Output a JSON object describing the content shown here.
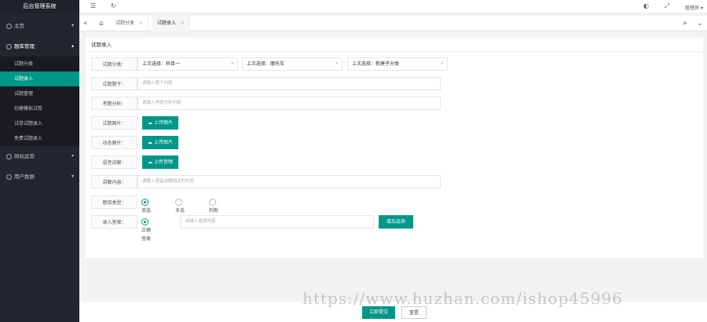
{
  "app": {
    "title": "后台管理系统"
  },
  "sidebar": {
    "items": [
      {
        "label": "主页",
        "arrow": "▾"
      },
      {
        "label": "题库管理",
        "arrow": "▴"
      },
      {
        "label": "网站运营",
        "arrow": "▾"
      },
      {
        "label": "用户数据",
        "arrow": "▾"
      }
    ],
    "sub": [
      "试题分类",
      "试题录入",
      "试题管理",
      "创建模拟试卷",
      "试卷试题录入",
      "免费试题录入"
    ]
  },
  "header": {
    "menu_icon": "☰",
    "refresh_icon": "↻",
    "skin_icon": "◐",
    "full_icon": "⤢",
    "user": "管理员 ▾"
  },
  "tabs": {
    "prev": "«",
    "home": "⌂",
    "items": [
      "试题分类",
      "试题录入"
    ],
    "close": "×",
    "next": "»",
    "more": "⌄"
  },
  "card": {
    "title": "试题录入"
  },
  "form": {
    "category_label": "试题分类：",
    "selects": [
      "上次选择：科目一",
      "上次选择：摩托车",
      "上次选择：新建子分类"
    ],
    "caret": "▾",
    "stem_label": "试题题干：",
    "stem_placeholder": "请输入题干内容",
    "analysis_label": "考题分析：",
    "analysis_placeholder": "请输入考题分析内容",
    "image_label": "试题图片：",
    "image_btn": "上传图片",
    "gif_label": "动态图片：",
    "gif_btn": "上传图片",
    "audio_label": "语音讲解：",
    "audio_btn": "上传音频",
    "explain_label": "讲解内容：",
    "explain_placeholder": "请输入语音讲解相关的内容",
    "type_label": "题目类型：",
    "types": [
      "单选",
      "多选",
      "判断"
    ],
    "answer_label": "录入答案：",
    "answer_radio": "正确答案",
    "answer_placeholder": "请输入选项内容",
    "add_option": "增加选项"
  },
  "footer": {
    "submit": "立即提交",
    "reset": "重置"
  },
  "watermark": "https://www.huzhan.com/ishop45996",
  "colors": {
    "accent": "#009688",
    "sidebar": "#23262e"
  }
}
